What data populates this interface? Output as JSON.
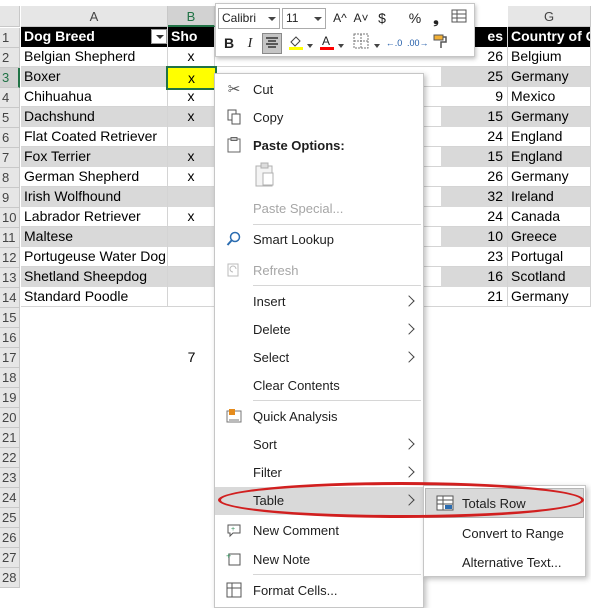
{
  "columns": [
    "A",
    "B",
    "G"
  ],
  "rows": [
    "1",
    "2",
    "3",
    "4",
    "5",
    "6",
    "7",
    "8",
    "9",
    "10",
    "11",
    "12",
    "13",
    "14",
    "15",
    "16",
    "17",
    "18",
    "19",
    "20",
    "21",
    "22",
    "23",
    "24",
    "25",
    "26",
    "27",
    "28"
  ],
  "table": {
    "headers": {
      "a": "Dog Breed",
      "b": "Sho",
      "f": "es",
      "g": "Country of Or"
    },
    "data": [
      {
        "a": "Belgian Shepherd",
        "b": "x",
        "f": "26",
        "g": "Belgium"
      },
      {
        "a": "Boxer",
        "b": "x",
        "f": "25",
        "g": "Germany"
      },
      {
        "a": "Chihuahua",
        "b": "x",
        "f": "9",
        "g": "Mexico"
      },
      {
        "a": "Dachshund",
        "b": "x",
        "f": "15",
        "g": "Germany"
      },
      {
        "a": "Flat Coated Retriever",
        "b": "",
        "f": "24",
        "g": "England"
      },
      {
        "a": "Fox Terrier",
        "b": "x",
        "f": "15",
        "g": "England"
      },
      {
        "a": "German Shepherd",
        "b": "x",
        "f": "26",
        "g": "Germany"
      },
      {
        "a": "Irish Wolfhound",
        "b": "",
        "f": "32",
        "g": "Ireland"
      },
      {
        "a": "Labrador Retriever",
        "b": "x",
        "f": "24",
        "g": "Canada"
      },
      {
        "a": "Maltese",
        "b": "",
        "f": "10",
        "g": "Greece"
      },
      {
        "a": "Portugeuse Water Dog",
        "b": "",
        "f": "23",
        "g": "Portugal"
      },
      {
        "a": "Shetland Sheepdog",
        "b": "",
        "f": "16",
        "g": "Scotland"
      },
      {
        "a": "Standard Poodle",
        "b": "",
        "f": "21",
        "g": "Germany"
      }
    ],
    "row17_b": "7"
  },
  "minibar": {
    "font": "Calibri",
    "size": "11",
    "grow": "A^",
    "shrink": "A˅",
    "currency": "$",
    "percent": "%",
    "comma": "❟",
    "bold": "B",
    "italic": "I"
  },
  "context_menu": {
    "cut": "Cut",
    "copy": "Copy",
    "paste_options": "Paste Options:",
    "paste_special": "Paste Special...",
    "smart_lookup": "Smart Lookup",
    "refresh": "Refresh",
    "insert": "Insert",
    "delete": "Delete",
    "select": "Select",
    "clear_contents": "Clear Contents",
    "quick_analysis": "Quick Analysis",
    "sort": "Sort",
    "filter": "Filter",
    "table": "Table",
    "new_comment": "New Comment",
    "new_note": "New Note",
    "format_cells": "Format Cells..."
  },
  "table_submenu": {
    "totals_row": "Totals Row",
    "convert_to_range": "Convert to Range",
    "alternative_text": "Alternative Text..."
  },
  "colors": {
    "header_fill": "#000000",
    "band_fill": "#d9d9d9",
    "selected_cell": "#ffff00",
    "excel_green": "#217346",
    "annotation_red": "#d11f1f"
  }
}
